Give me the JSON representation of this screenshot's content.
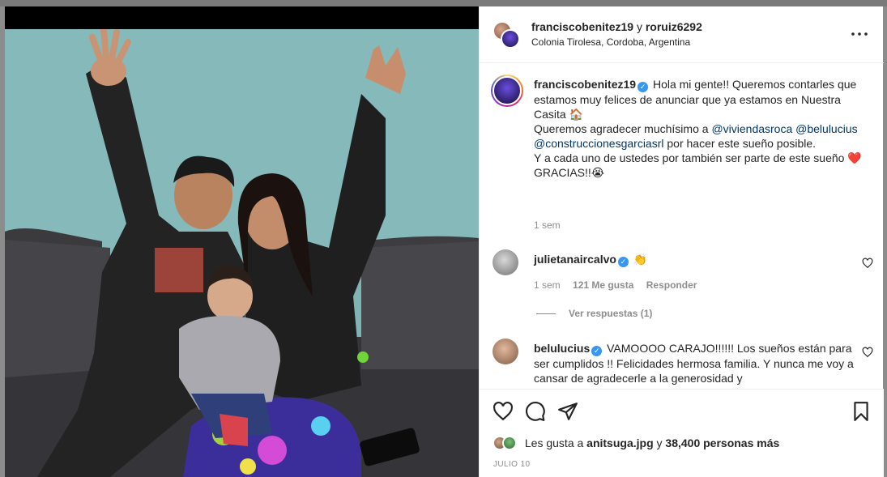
{
  "post": {
    "authors": {
      "primary": "franciscobenitez19",
      "joiner": "y",
      "secondary": "roruiz6292"
    },
    "location": "Colonia Tirolesa, Cordoba, Argentina"
  },
  "caption": {
    "username": "franciscobenitez19",
    "line1": "Hola mi gente!! Queremos contarles que estamos muy felices de anunciar que ya estamos en Nuestra Casita 🏠",
    "line2_prefix": "Queremos agradecer muchísimo a ",
    "mention1": "@viviendasroca",
    "mention2": "@belulucius",
    "mention3": "@construccionesgarciasrl",
    "line2_suffix": " por hacer este sueño posible.",
    "line3": "Y a cada uno de ustedes por también ser parte de este sueño ❤️",
    "line4": "GRACIAS!!😭",
    "time": "1 sem"
  },
  "comments": [
    {
      "username": "julietanaircalvo",
      "text": "👏",
      "time": "1 sem",
      "likes": "121 Me gusta",
      "reply": "Responder",
      "view_replies": "Ver respuestas (1)"
    },
    {
      "username": "belulucius",
      "text": "VAMOOOO CARAJO!!!!!! Los sueños están para ser cumplidos !! Felicidades hermosa familia. Y nunca me voy a cansar de agradecerle a la generosidad y"
    }
  ],
  "likes": {
    "prefix": "Les gusta a",
    "user": "anitsuga.jpg",
    "joiner": "y",
    "count": "38,400 personas más"
  },
  "date": "JULIO 10",
  "icons": [
    "more-icon",
    "verified-icon",
    "heart-icon",
    "comment-icon",
    "share-icon",
    "save-icon"
  ],
  "colors": {
    "mention": "#00376b",
    "verified": "#3897f0",
    "muted": "#8e8e8e"
  }
}
